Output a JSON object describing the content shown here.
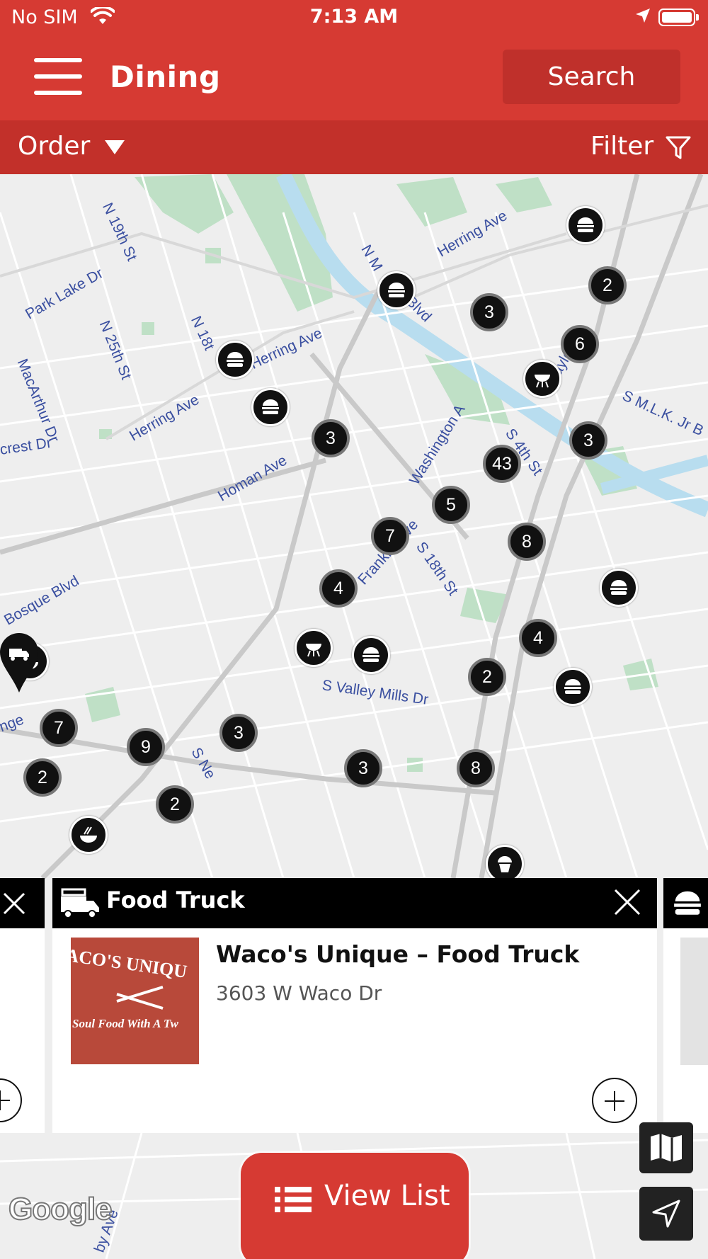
{
  "status_bar": {
    "carrier": "No SIM",
    "time": "7:13 AM"
  },
  "header": {
    "title": "Dining",
    "search_label": "Search"
  },
  "toolbar": {
    "order_label": "Order",
    "filter_label": "Filter"
  },
  "map": {
    "streets": {
      "n19th": "N 19th St",
      "parklake": "Park Lake Dr",
      "n25th": "N 25th St",
      "macarthur": "MacArthur Dr",
      "n18th": "N 18t",
      "herring1": "Herring Ave",
      "herring2": "Herring Ave",
      "herring3": "Herring Ave",
      "mlk1": "N M",
      "mlk1b": "Jr Blvd",
      "taylor": "Taylor S",
      "smlk": "S M.L.K. Jr B",
      "crest": "crest Dr",
      "homan": "Homan Ave",
      "washington": "Washington A",
      "s4th": "S 4th St",
      "franklin": "Franklin Ave",
      "s18th": "S 18th St",
      "bosque": "Bosque Blvd",
      "valleymills": "S Valley Mills Dr",
      "sne": "S Ne",
      "ange": "nge",
      "bottom": "by Ave"
    },
    "clusters": [
      "3",
      "2",
      "6",
      "3",
      "3",
      "43",
      "5",
      "7",
      "8",
      "4",
      "4",
      "2",
      "7",
      "9",
      "3",
      "3",
      "8",
      "2",
      "2"
    ],
    "google_label": "Google"
  },
  "card": {
    "category": "Food Truck",
    "name": "Waco's Unique – Food Truck",
    "address": "3603 W Waco Dr",
    "photo_text_top": "ACO'S UNIQU",
    "photo_text_bottom": "Soul Food With A Tw"
  },
  "view_list_label": "View List"
}
